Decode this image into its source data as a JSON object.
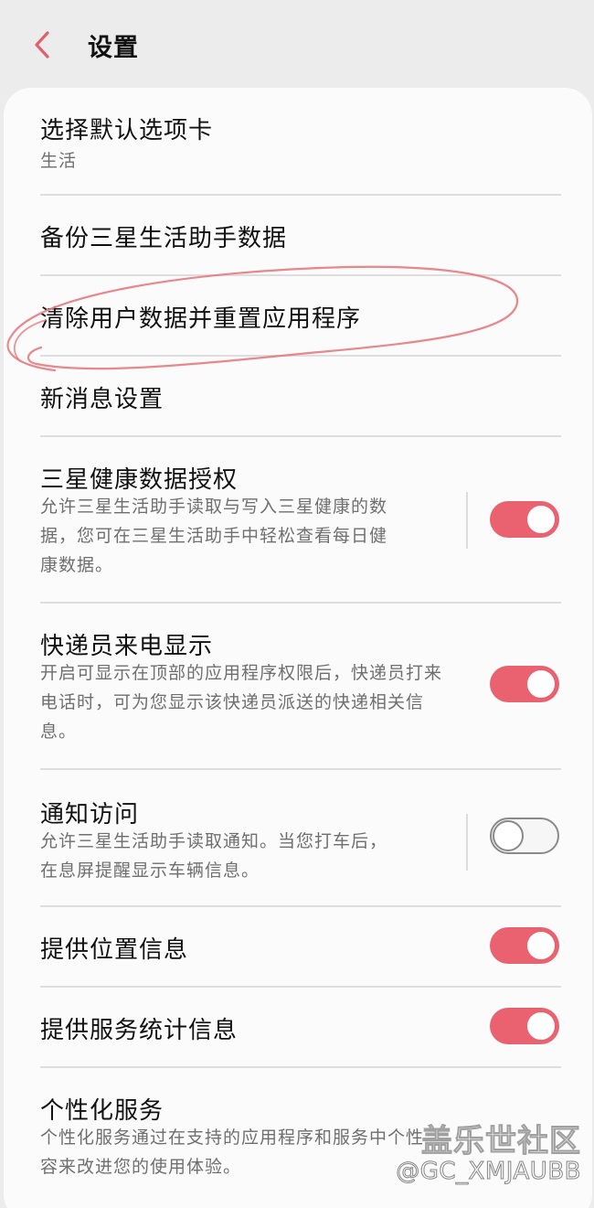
{
  "header": {
    "back_icon": "chevron-left-icon",
    "title": "设置"
  },
  "rows": [
    {
      "title": "选择默认选项卡",
      "subtitle": "生活"
    },
    {
      "title": "备份三星生活助手数据"
    },
    {
      "title": "清除用户数据并重置应用程序"
    },
    {
      "title": "新消息设置"
    },
    {
      "title": "三星健康数据授权",
      "subtitle_lines": [
        "允许三星生活助手读取与写入三星健康的数",
        "据，您可在三星生活助手中轻松查看每日健",
        "康数据。"
      ],
      "toggle": "on"
    },
    {
      "title": "快递员来电显示",
      "subtitle_lines": [
        "开启可显示在顶部的应用程序权限后，快递员打来",
        "电话时，可为您显示该快递员派送的快递相关信",
        "息。"
      ],
      "toggle": "on"
    },
    {
      "title": "通知访问",
      "subtitle_lines": [
        "允许三星生活助手读取通知。当您打车后，",
        "在息屏提醒显示车辆信息。"
      ],
      "toggle": "off"
    },
    {
      "title": "提供位置信息",
      "toggle": "on"
    },
    {
      "title": "提供服务统计信息",
      "toggle": "on"
    },
    {
      "title": "个性化服务",
      "subtitle_lines": [
        "个性化服务通过在支持的应用程序和服务中个性",
        "容来改进您的使用体验。"
      ]
    }
  ],
  "watermark": {
    "line1": "盖乐世社区",
    "line2": "@GC_XMJAUBB"
  },
  "colors": {
    "accent": "#ea6170",
    "background": "#ececec",
    "card": "#fbfbfb"
  }
}
